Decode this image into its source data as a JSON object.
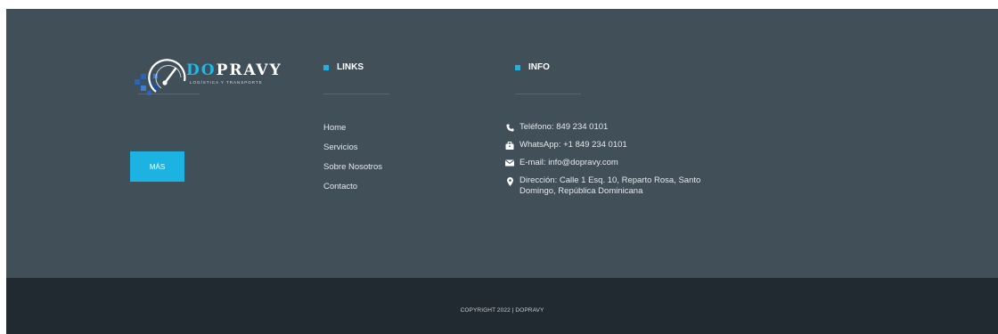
{
  "logo": {
    "brand_prefix": "DO",
    "brand_suffix": "PRAVY",
    "tagline": "LOGÍSTICA Y TRANSPORTE"
  },
  "button": {
    "label": "MÁS"
  },
  "links": {
    "title": "LINKS",
    "items": [
      "Home",
      "Servicios",
      "Sobre Nosotros",
      "Contacto"
    ]
  },
  "info": {
    "title": "INFO",
    "items": [
      {
        "icon": "phone-icon",
        "text": "Teléfono: 849 234 0101"
      },
      {
        "icon": "briefcase-icon",
        "text": "WhatsApp: +1 849 234 0101"
      },
      {
        "icon": "envelope-icon",
        "text": "E-mail: info@dopravy.com"
      },
      {
        "icon": "map-marker-icon",
        "text": "Dirección: Calle 1 Esq. 10, Reparto Rosa, Santo Domingo, República Dominicana"
      }
    ]
  },
  "copyright": "COPYRIGHT 2022 | DOPRAVY",
  "colors": {
    "footer_bg": "#414f59",
    "bottom_bg": "#212a30",
    "accent": "#1cb3e2"
  }
}
